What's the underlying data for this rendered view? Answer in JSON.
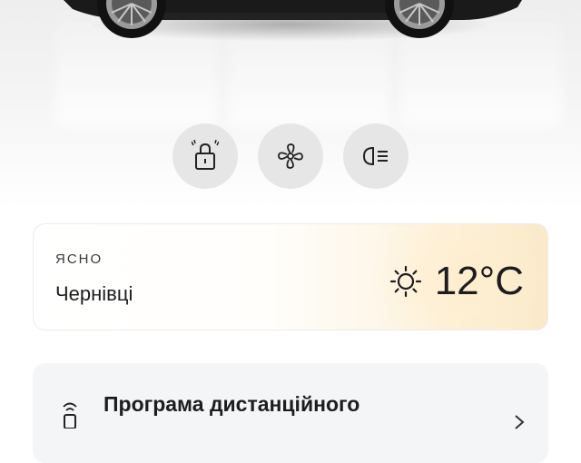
{
  "quick_controls": [
    {
      "name": "lock",
      "icon": "padlock-icon"
    },
    {
      "name": "climate",
      "icon": "fan-icon"
    },
    {
      "name": "headlights",
      "icon": "headlight-icon"
    }
  ],
  "weather": {
    "condition": "ЯСНО",
    "city": "Чернівці",
    "temperature": "12°C",
    "icon": "sun-icon"
  },
  "remote_program": {
    "title": "Програма дистанційного",
    "icon": "remote-key-icon",
    "chevron": "chevron-right-icon"
  },
  "colors": {
    "button_bg": "#e6e6e6",
    "card_warm": "#fae9c9",
    "text": "#1d1d1f"
  }
}
